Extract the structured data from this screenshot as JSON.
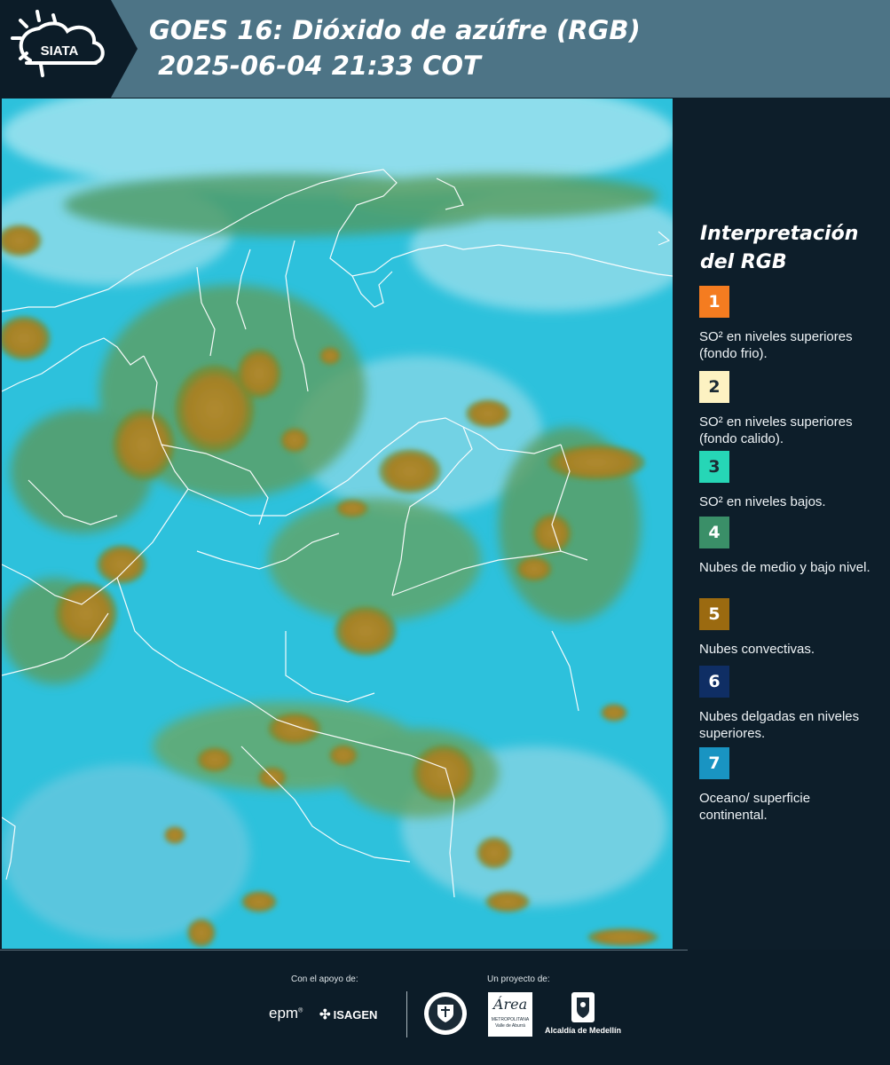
{
  "header": {
    "logo_text": "SIATA",
    "title": "GOES 16: Dióxido de azúfre (RGB)\n 2025-06-04 21:33 COT"
  },
  "legend": {
    "title": "Interpretación\ndel RGB",
    "items": [
      {
        "number": "1",
        "text": "SO² en niveles superiores (fondo frio).",
        "color": "#f47c20",
        "text_color": "#ffffff"
      },
      {
        "number": "2",
        "text": "SO² en niveles superiores (fondo calido).",
        "color": "#fdf2c2",
        "text_color": "#1b2a33"
      },
      {
        "number": "3",
        "text": "SO² en niveles bajos.",
        "color": "#26d6b6",
        "text_color": "#1b2a33"
      },
      {
        "number": "4",
        "text": "Nubes de medio y bajo nivel.",
        "color": "#3a8f68",
        "text_color": "#ffffff"
      },
      {
        "number": "5",
        "text": "Nubes convectivas.",
        "color": "#9b6a10",
        "text_color": "#ffffff"
      },
      {
        "number": "6",
        "text": "Nubes delgadas en niveles superiores.",
        "color": "#0f2e64",
        "text_color": "#ffffff"
      },
      {
        "number": "7",
        "text": "Oceano/ superficie continental.",
        "color": "#1994c2",
        "text_color": "#ffffff"
      }
    ]
  },
  "footer": {
    "support_label": "Con el apoyo de:",
    "project_label": "Un proyecto de:",
    "epm_logo": "epm",
    "isagen_logo": "ISAGEN",
    "area_logo": "Área",
    "area_subtitle": "METROPOLITANA Valle de Aburrá",
    "alcaldia_label": "Alcaldía de Medellín",
    "medellin_seal": "MEDELLÍN"
  },
  "colors": {
    "header_bg": "#4d7486",
    "dark_bg": "#0c1c28",
    "map_surface": "#2ec3de",
    "convective_cloud": "#a98a2a"
  }
}
